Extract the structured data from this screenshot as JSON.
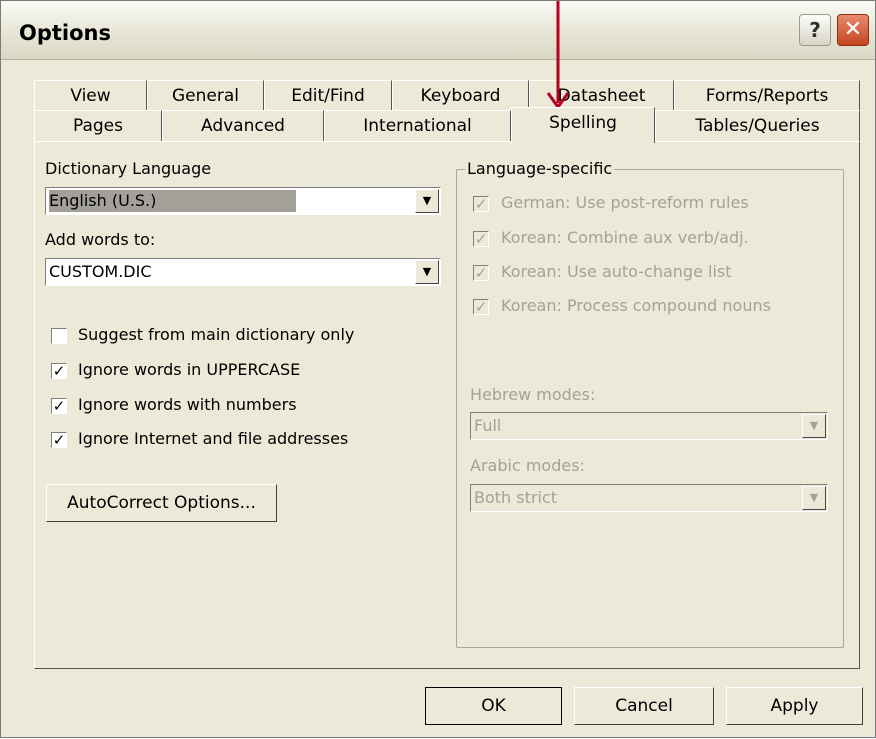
{
  "window": {
    "title": "Options",
    "help_label": "?",
    "close_label": "✕"
  },
  "tabs_row1": [
    {
      "label": "View"
    },
    {
      "label": "General"
    },
    {
      "label": "Edit/Find"
    },
    {
      "label": "Keyboard"
    },
    {
      "label": "Datasheet"
    },
    {
      "label": "Forms/Reports"
    }
  ],
  "tabs_row2": [
    {
      "label": "Pages"
    },
    {
      "label": "Advanced"
    },
    {
      "label": "International"
    },
    {
      "label": "Spelling"
    },
    {
      "label": "Tables/Queries"
    }
  ],
  "active_tab": "Spelling",
  "spelling": {
    "dictionary_language_label": "Dictionary Language",
    "dictionary_language_value": "English (U.S.)",
    "add_words_label": "Add words to:",
    "add_words_value": "CUSTOM.DIC",
    "options": [
      {
        "label": "Suggest from main dictionary only",
        "checked": false
      },
      {
        "label": "Ignore words in UPPERCASE",
        "checked": true
      },
      {
        "label": "Ignore words with numbers",
        "checked": true
      },
      {
        "label": "Ignore Internet and file addresses",
        "checked": true
      }
    ],
    "autocorrect_button": "AutoCorrect Options..."
  },
  "language_specific": {
    "legend": "Language-specific",
    "options": [
      {
        "label": "German: Use post-reform rules",
        "checked": true
      },
      {
        "label": "Korean: Combine aux verb/adj.",
        "checked": true
      },
      {
        "label": "Korean: Use auto-change list",
        "checked": true
      },
      {
        "label": "Korean: Process compound nouns",
        "checked": true
      }
    ],
    "hebrew_label": "Hebrew modes:",
    "hebrew_value": "Full",
    "arabic_label": "Arabic modes:",
    "arabic_value": "Both strict"
  },
  "buttons": {
    "ok": "OK",
    "cancel": "Cancel",
    "apply": "Apply"
  },
  "check_glyph": "✓",
  "dropdown_glyph": "▼",
  "annotation_color": "#b5001f"
}
